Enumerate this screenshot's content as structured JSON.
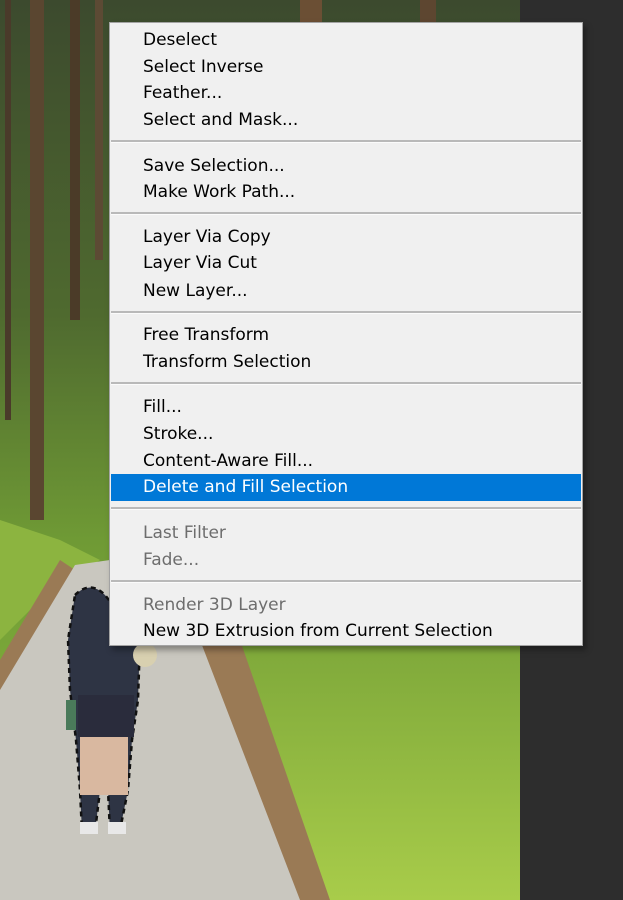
{
  "menu": {
    "groups": [
      {
        "items": [
          {
            "label": "Deselect",
            "enabled": true
          },
          {
            "label": "Select Inverse",
            "enabled": true
          },
          {
            "label": "Feather...",
            "enabled": true
          },
          {
            "label": "Select and Mask...",
            "enabled": true
          }
        ]
      },
      {
        "items": [
          {
            "label": "Save Selection...",
            "enabled": true
          },
          {
            "label": "Make Work Path...",
            "enabled": true
          }
        ]
      },
      {
        "items": [
          {
            "label": "Layer Via Copy",
            "enabled": true
          },
          {
            "label": "Layer Via Cut",
            "enabled": true
          },
          {
            "label": "New Layer...",
            "enabled": true
          }
        ]
      },
      {
        "items": [
          {
            "label": "Free Transform",
            "enabled": true
          },
          {
            "label": "Transform Selection",
            "enabled": true
          }
        ]
      },
      {
        "items": [
          {
            "label": "Fill...",
            "enabled": true
          },
          {
            "label": "Stroke...",
            "enabled": true
          },
          {
            "label": "Content-Aware Fill...",
            "enabled": true
          },
          {
            "label": "Delete and Fill Selection",
            "enabled": true,
            "highlighted": true
          }
        ]
      },
      {
        "items": [
          {
            "label": "Last Filter",
            "enabled": false
          },
          {
            "label": "Fade...",
            "enabled": false
          }
        ]
      },
      {
        "items": [
          {
            "label": "Render 3D Layer",
            "enabled": false
          },
          {
            "label": "New 3D Extrusion from Current Selection",
            "enabled": true
          }
        ]
      }
    ]
  },
  "colors": {
    "highlight": "#0078d7",
    "menu_background": "#f0f0f0",
    "disabled_text": "#6d6d6d"
  }
}
